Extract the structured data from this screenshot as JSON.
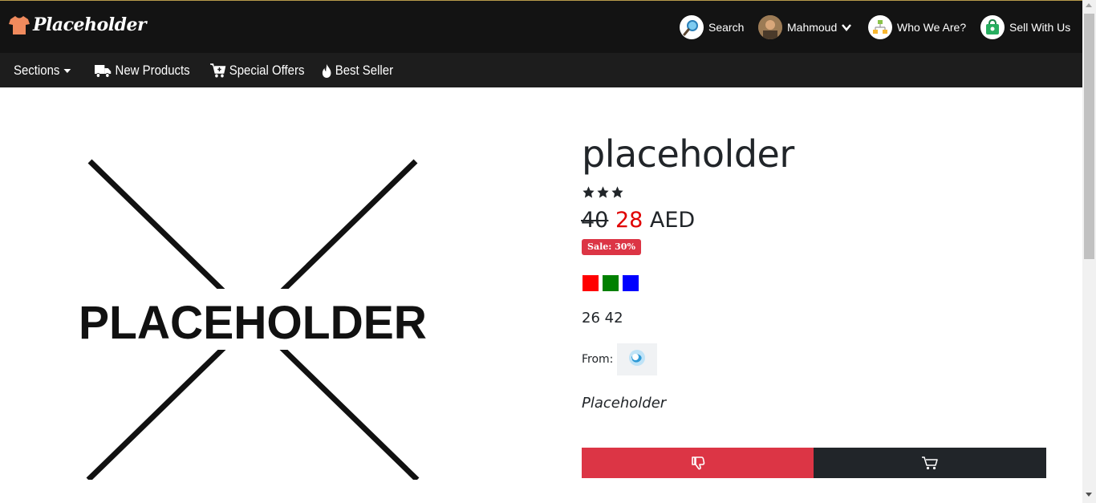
{
  "brand": {
    "name": "Placeholder"
  },
  "topbar": {
    "search_label": "Search",
    "user_name": "Mahmoud",
    "who_label": "Who We Are?",
    "sell_label": "Sell With Us"
  },
  "nav": {
    "sections_label": "Sections",
    "new_products_label": "New Products",
    "special_offers_label": "Special Offers",
    "best_seller_label": "Best Seller"
  },
  "product": {
    "image_text": "PLACEHOLDER",
    "title": "placeholder",
    "rating": 3,
    "old_price": "40",
    "new_price": "28",
    "currency": "AED",
    "sale_badge": "Sale: 30%",
    "colors": [
      "#ff0000",
      "#008000",
      "#0000ff"
    ],
    "sizes": "26 42",
    "from_label": "From:",
    "description": "Placeholder"
  },
  "actions": {
    "dislike_icon": "thumbs-down-icon",
    "cart_icon": "cart-icon"
  },
  "theme": {
    "header_bg": "#131313",
    "nav_bg": "#1d1d1d",
    "danger": "#dc3545",
    "dark": "#212529",
    "sale_price": "#e00000"
  }
}
